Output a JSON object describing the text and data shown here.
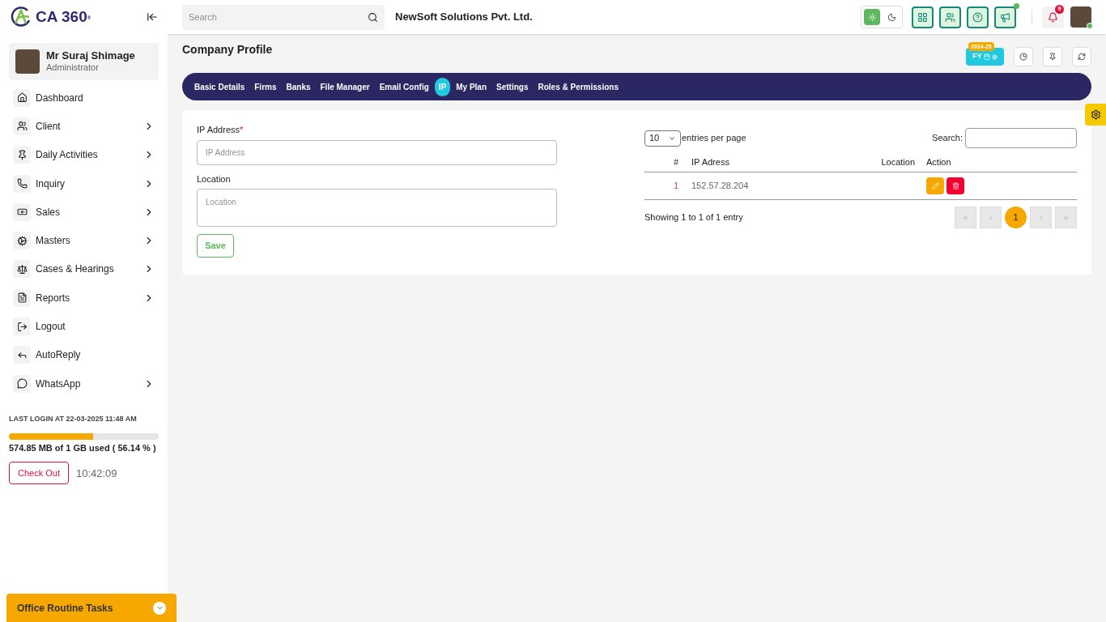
{
  "logo": {
    "text": "CA 360",
    "mark": "®"
  },
  "user": {
    "name": "Mr Suraj Shimage",
    "role": "Administrator"
  },
  "sidebar": {
    "items": [
      {
        "label": "Dashboard",
        "has_submenu": false
      },
      {
        "label": "Client",
        "has_submenu": true
      },
      {
        "label": "Daily Activities",
        "has_submenu": true
      },
      {
        "label": "Inquiry",
        "has_submenu": true
      },
      {
        "label": "Sales",
        "has_submenu": true
      },
      {
        "label": "Masters",
        "has_submenu": true
      },
      {
        "label": "Cases & Hearings",
        "has_submenu": true
      },
      {
        "label": "Reports",
        "has_submenu": true
      },
      {
        "label": "Logout",
        "has_submenu": false
      },
      {
        "label": "AutoReply",
        "has_submenu": false
      },
      {
        "label": "WhatsApp",
        "has_submenu": true
      }
    ]
  },
  "last_login": "LAST LOGIN AT 22-03-2025 11:48 AM",
  "storage": {
    "level": 0.5614,
    "reading": "574.85 MB of 1 GB used ( 56.14 % )"
  },
  "check_out": {
    "label": "Check Out",
    "time": "10:42:09"
  },
  "routine_bar": {
    "label": "Office Routine Tasks"
  },
  "header": {
    "search_placeholder": "Search",
    "company": "NewSoft Solutions Pvt. Ltd.",
    "theme": [
      {
        "kind": "light",
        "selected": true
      },
      {
        "kind": "dark",
        "selected": false
      }
    ],
    "notification_count": "9"
  },
  "page": {
    "title": "Company Profile",
    "fy_label": "FY",
    "fy_year": "2024-25"
  },
  "tabs": [
    {
      "label": "Basic Details",
      "selected": false
    },
    {
      "label": "Firms",
      "selected": false
    },
    {
      "label": "Banks",
      "selected": false
    },
    {
      "label": "File Manager",
      "selected": false
    },
    {
      "label": "Email Config",
      "selected": false
    },
    {
      "label": "IP",
      "selected": true
    },
    {
      "label": "My Plan",
      "selected": false
    },
    {
      "label": "Settings",
      "selected": false
    },
    {
      "label": "Roles & Permissions",
      "selected": false
    }
  ],
  "form": {
    "fields": [
      {
        "label": "IP Address",
        "required_mark": "*",
        "placeholder": "IP Address",
        "kind": "input"
      },
      {
        "label": "Location",
        "placeholder": "Location",
        "kind": "textarea"
      }
    ],
    "save": "Save"
  },
  "table": {
    "page_size": "10",
    "page_size_label": "entries per page",
    "search_label": "Search:",
    "columns": [
      "#",
      "IP Adress",
      "Location",
      "Action"
    ],
    "rows": [
      {
        "index": "1",
        "ip": "152.57.28.204"
      }
    ],
    "info": "Showing 1 to 1 of 1 entry",
    "pagination": [
      {
        "label": "«",
        "selected": false,
        "disabled": true
      },
      {
        "label": "‹",
        "selected": false,
        "disabled": true
      },
      {
        "label": "1",
        "selected": true,
        "disabled": false
      },
      {
        "label": "›",
        "selected": false,
        "disabled": true
      },
      {
        "label": "»",
        "selected": false,
        "disabled": true
      }
    ]
  }
}
